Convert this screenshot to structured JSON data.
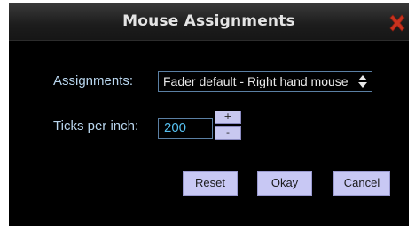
{
  "dialog": {
    "title": "Mouse Assignments",
    "close_icon": "close-x-icon",
    "accent_close": "#c8321e",
    "background": "#000000"
  },
  "assignments": {
    "label": "Assignments:",
    "selected": "Fader default - Right hand mouse"
  },
  "ticks": {
    "label": "Ticks per inch:",
    "value": "200",
    "increment_label": "+",
    "decrement_label": "-"
  },
  "buttons": {
    "reset": "Reset",
    "okay": "Okay",
    "cancel": "Cancel"
  }
}
